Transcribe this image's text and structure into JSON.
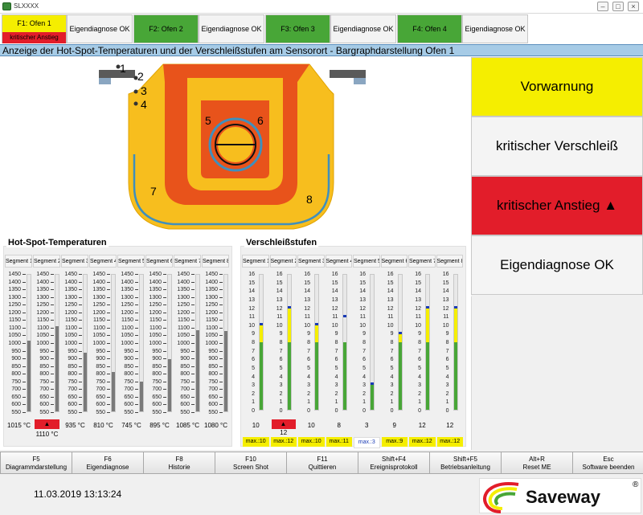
{
  "window": {
    "title": "SLXXXX"
  },
  "tabs": [
    {
      "ofen": "F1: Ofen 1",
      "ofen_status": "kritischer Anstieg",
      "diag": "Eigendiagnose OK"
    },
    {
      "ofen": "F2: Ofen 2",
      "diag": "Eigendiagnose OK"
    },
    {
      "ofen": "F3: Ofen 3",
      "diag": "Eigendiagnose OK"
    },
    {
      "ofen": "F4: Ofen 4",
      "diag": "Eigendiagnose OK"
    }
  ],
  "header": {
    "title": "Anzeige der Hot-Spot-Temperaturen und der Verschleißstufen am Sensorort - Bargraphdarstellung Ofen 1"
  },
  "sensor_labels": [
    "1",
    "2",
    "3",
    "4",
    "5",
    "6",
    "7",
    "8"
  ],
  "status": {
    "vorwarnung": "Vorwarnung",
    "kritischer_verschleiss": "kritischer Verschleiß",
    "kritischer_anstieg": "kritischer Anstieg ▲",
    "eigendiagnose": "Eigendiagnose OK"
  },
  "colors": {
    "yellow": "#f5ee00",
    "red": "#e21d2a",
    "green": "#48a637",
    "gray_bar": "#7a7a7a",
    "blue_marker": "#1a3bb5",
    "header_blue": "#a6cbe6"
  },
  "hotspot": {
    "title": "Hot-Spot-Temperaturen",
    "segments": [
      "Segment 1",
      "Segment 2",
      "Segment 3",
      "Segment 4",
      "Segment 5",
      "Segment 6",
      "Segment 7",
      "Segment 8"
    ],
    "ticks": [
      "1450",
      "1400",
      "1350",
      "1300",
      "1250",
      "1200",
      "1150",
      "1100",
      "1050",
      "1000",
      "950",
      "900",
      "850",
      "800",
      "750",
      "700",
      "650",
      "600",
      "550"
    ],
    "values": [
      1015,
      1110,
      935,
      810,
      745,
      895,
      1085,
      1080
    ],
    "labels": [
      "1015 °C",
      "1110 °C",
      "935 °C",
      "810 °C",
      "745 °C",
      "895 °C",
      "1085 °C",
      "1080 °C"
    ],
    "alert": [
      false,
      true,
      false,
      false,
      false,
      false,
      false,
      false
    ],
    "alert_symbol": "▲",
    "min": 550,
    "max": 1450
  },
  "wear": {
    "title": "Verschleißstufen",
    "segments": [
      "Segment 1",
      "Segment 2",
      "Segment 3",
      "Segment 4",
      "Segment 5",
      "Segment 6",
      "Segment 7",
      "Segment 8"
    ],
    "ticks": [
      "16",
      "15",
      "14",
      "13",
      "12",
      "11",
      "10",
      "9",
      "8",
      "7",
      "6",
      "5",
      "4",
      "3",
      "2",
      "1",
      "0"
    ],
    "values": [
      10,
      12,
      10,
      8,
      3,
      9,
      12,
      12
    ],
    "max_values": [
      10,
      12,
      10,
      11,
      3,
      9,
      12,
      12
    ],
    "max_labels": [
      "max.:10",
      "max.:12",
      "max.:10",
      "max.:11",
      "max.:3",
      "max.:9",
      "max.:12",
      "max.:12"
    ],
    "alert": [
      false,
      true,
      false,
      false,
      false,
      false,
      false,
      false
    ],
    "alert_symbol": "▲",
    "max_blue": [
      false,
      false,
      false,
      false,
      true,
      false,
      false,
      false
    ]
  },
  "fkeys": [
    {
      "key": "F5",
      "label": "Diagrammdarstellung"
    },
    {
      "key": "F6",
      "label": "Eigendiagnose"
    },
    {
      "key": "F8",
      "label": "Historie"
    },
    {
      "key": "F10",
      "label": "Screen Shot"
    },
    {
      "key": "F11",
      "label": "Quittieren"
    },
    {
      "key": "Shift+F4",
      "label": "Ereignisprotokoll"
    },
    {
      "key": "Shift+F5",
      "label": "Betriebsanleitung"
    },
    {
      "key": "Alt+R",
      "label": "Reset ME"
    },
    {
      "key": "Esc",
      "label": "Software beenden"
    }
  ],
  "footer": {
    "datetime": "11.03.2019 13:13:24",
    "logo": "Saveway",
    "logo_reg": "®"
  }
}
